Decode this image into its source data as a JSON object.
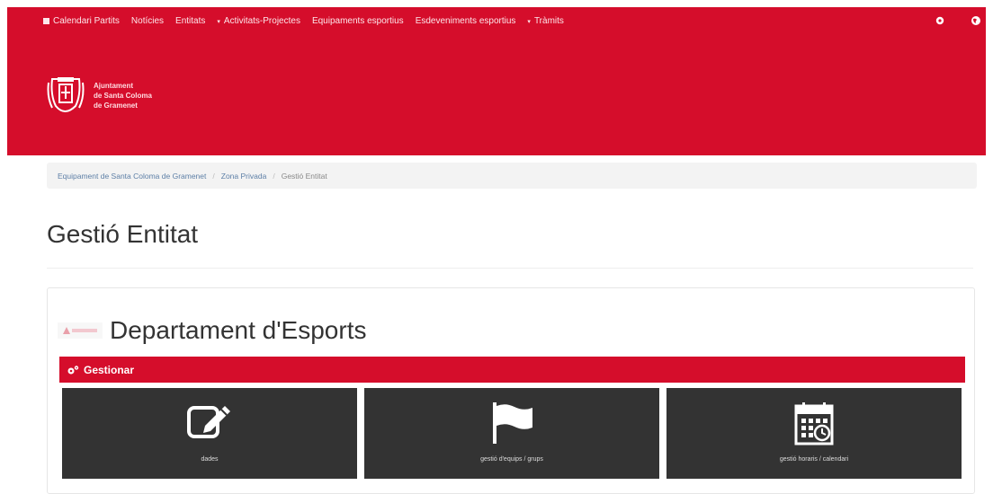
{
  "nav": {
    "items": [
      {
        "label": "Calendari Partits"
      },
      {
        "label": "Notícies"
      },
      {
        "label": "Entitats"
      },
      {
        "label": "Activitats-Projectes"
      },
      {
        "label": "Equipaments esportius"
      },
      {
        "label": "Esdeveniments esportius"
      },
      {
        "label": "Tràmits"
      }
    ]
  },
  "brand": {
    "line1": "Ajuntament",
    "line2": "de Santa Coloma",
    "line3": "de Gramenet"
  },
  "breadcrumb": {
    "item1": "Equipament de Santa Coloma de Gramenet",
    "item2": "Zona Privada",
    "item3": "Gestió Entitat"
  },
  "page": {
    "title": "Gestió Entitat"
  },
  "department": {
    "name": "Departament d'Esports"
  },
  "manage": {
    "label": "Gestionar"
  },
  "tiles": [
    {
      "label": "dades"
    },
    {
      "label": "gestió d'equips / grups"
    },
    {
      "label": "gestió horaris / calendari"
    }
  ],
  "colors": {
    "accent": "#d50d2b",
    "tile": "#333333"
  }
}
